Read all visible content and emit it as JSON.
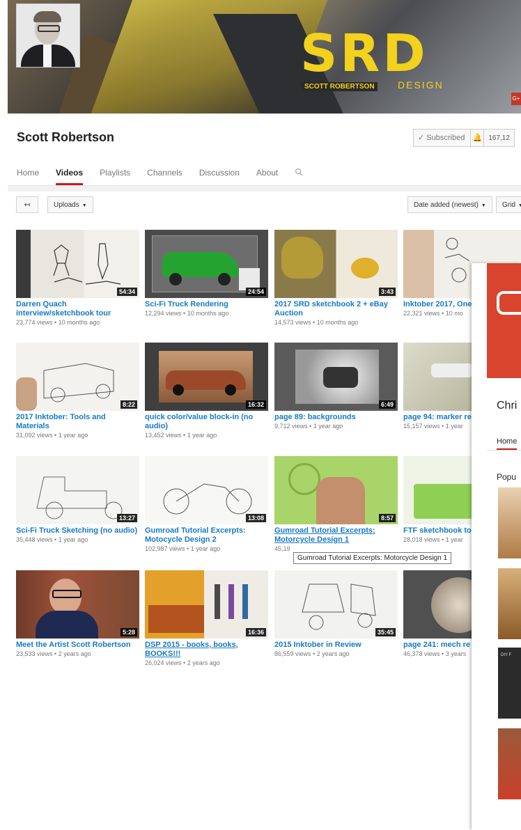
{
  "channel": {
    "name": "Scott Robertson",
    "subscribed_label": "Subscribed",
    "subscriber_count": "167,12"
  },
  "banner": {
    "logo_text": "SRD",
    "logo_sub_left": "SCOTT ROBERTSON",
    "logo_sub_right": "DESIGN",
    "badge": "G+"
  },
  "tabs": [
    "Home",
    "Videos",
    "Playlists",
    "Channels",
    "Discussion",
    "About"
  ],
  "active_tab": "Videos",
  "toolbar": {
    "uploads_label": "Uploads",
    "sort_label": "Date added (newest)",
    "view_label": "Grid"
  },
  "videos": [
    {
      "title": "Darren Quach interview/sketchbook tour",
      "duration": "54:34",
      "views": "23,774 views",
      "age": "10 months ago"
    },
    {
      "title": "Sci-Fi Truck Rendering",
      "duration": "24:54",
      "views": "12,294 views",
      "age": "10 months ago"
    },
    {
      "title": "2017 SRD sketchbook 2 + eBay Auction",
      "duration": "3:43",
      "views": "14,573 views",
      "age": "10 months ago"
    },
    {
      "title": "Inktober 2017, One",
      "duration": "",
      "views": "22,321 views",
      "age": "10 mo"
    },
    {
      "title": "2017 Inktober: Tools and Materials",
      "duration": "8:22",
      "views": "31,092 views",
      "age": "1 year ago"
    },
    {
      "title": "quick color/value block-in (no audio)",
      "duration": "16:32",
      "views": "13,452 views",
      "age": "1 year ago"
    },
    {
      "title": "page 89: backgrounds",
      "duration": "6:49",
      "views": "9,712 views",
      "age": "1 year ago"
    },
    {
      "title": "page 94: marker re",
      "duration": "",
      "views": "15,157 views",
      "age": "1 year"
    },
    {
      "title": "Sci-Fi Truck Sketching (no audio)",
      "duration": "13:27",
      "views": "35,448 views",
      "age": "1 year ago"
    },
    {
      "title": "Gumroad Tutorial Excerpts: Motocycle Design 2",
      "duration": "13:08",
      "views": "102,987 views",
      "age": "1 year ago"
    },
    {
      "title": "Gumroad Tutorial Excerpts: Motorcycle Design 1",
      "duration": "8:57",
      "views": "45,19",
      "age": ""
    },
    {
      "title": "FTF sketchbook to",
      "duration": "",
      "views": "28,018 views",
      "age": "1 year"
    },
    {
      "title": "Meet the Artist Scott Robertson",
      "duration": "5:28",
      "views": "23,533 views",
      "age": "2 years ago"
    },
    {
      "title": "DSP 2015 - books, books, BOOKS!!!",
      "duration": "16:36",
      "views": "26,024 views",
      "age": "2 years ago"
    },
    {
      "title": "2015 Inktober in Review",
      "duration": "35:45",
      "views": "86,559 views",
      "age": "2 years ago"
    },
    {
      "title": "page 241: mech re",
      "duration": "",
      "views": "46,378 views",
      "age": "3 years"
    }
  ],
  "tooltip": "Gumroad Tutorial Excerpts: Motorcycle Design 1",
  "overlay": {
    "channel_name": "Chri",
    "tab": "Home",
    "section": "Popu",
    "diy_text": "DIY F"
  },
  "colors": {
    "accent": "#cc181e",
    "link": "#167ac6",
    "logo": "#f2d21c"
  }
}
